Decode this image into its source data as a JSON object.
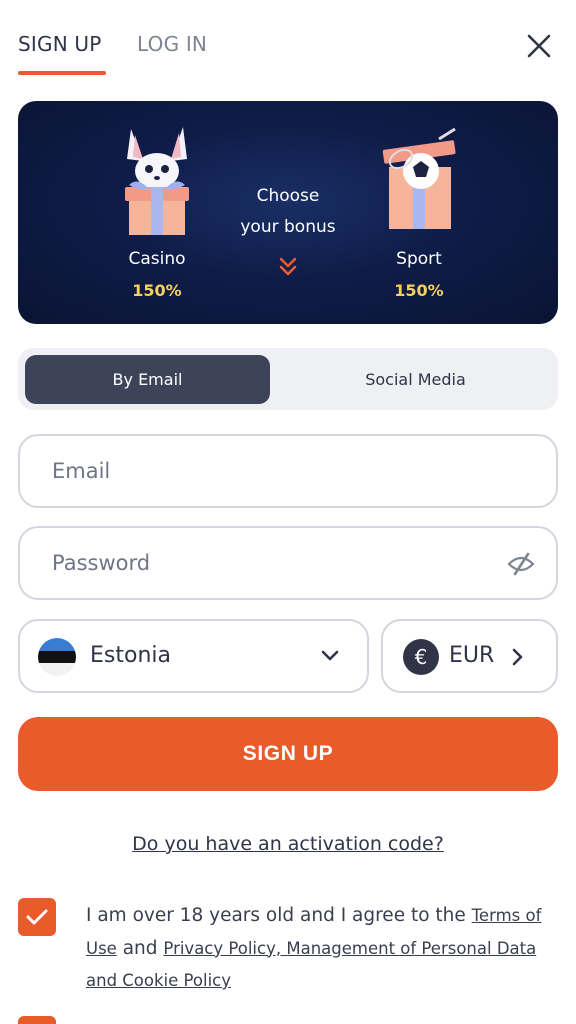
{
  "tabs": {
    "signup": "SIGN UP",
    "login": "LOG IN"
  },
  "banner": {
    "casino": {
      "name": "Casino",
      "percent": "150%"
    },
    "choose_line1": "Choose",
    "choose_line2": "your bonus",
    "sport": {
      "name": "Sport",
      "percent": "150%"
    }
  },
  "method": {
    "email": "By Email",
    "social": "Social Media"
  },
  "form": {
    "email_placeholder": "Email",
    "password_placeholder": "Password",
    "country": "Estonia",
    "currency_symbol": "€",
    "currency": "EUR",
    "submit": "SIGN UP"
  },
  "activation_link": "Do you have an activation code?",
  "terms": {
    "prefix": "I am over 18 years old and I agree to the ",
    "link1": "Terms of Use",
    "middle": " and ",
    "link2": "Privacy Policy, Management of Personal Data and Cookie Policy"
  },
  "colors": {
    "accent": "#ea5b2b",
    "dark": "#3d4459",
    "banner_bg": "#0f1c48",
    "percent": "#f4d15a"
  }
}
